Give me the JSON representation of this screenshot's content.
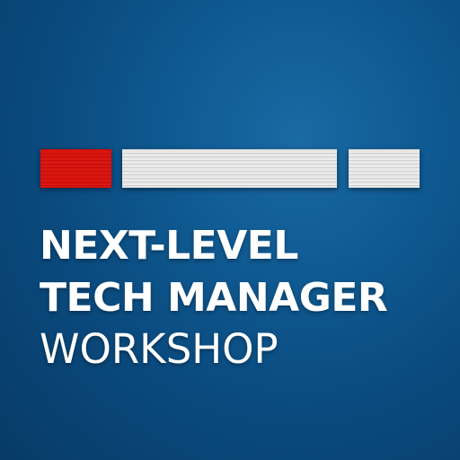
{
  "title": {
    "line1": "NEXT-LEVEL",
    "line2": "TECH MANAGER",
    "line3": "WORKSHOP"
  },
  "colors": {
    "background": "#0a4a7e",
    "accent_red": "#d8140f",
    "bar_gray": "#e6e6e6",
    "text": "#ffffff"
  }
}
